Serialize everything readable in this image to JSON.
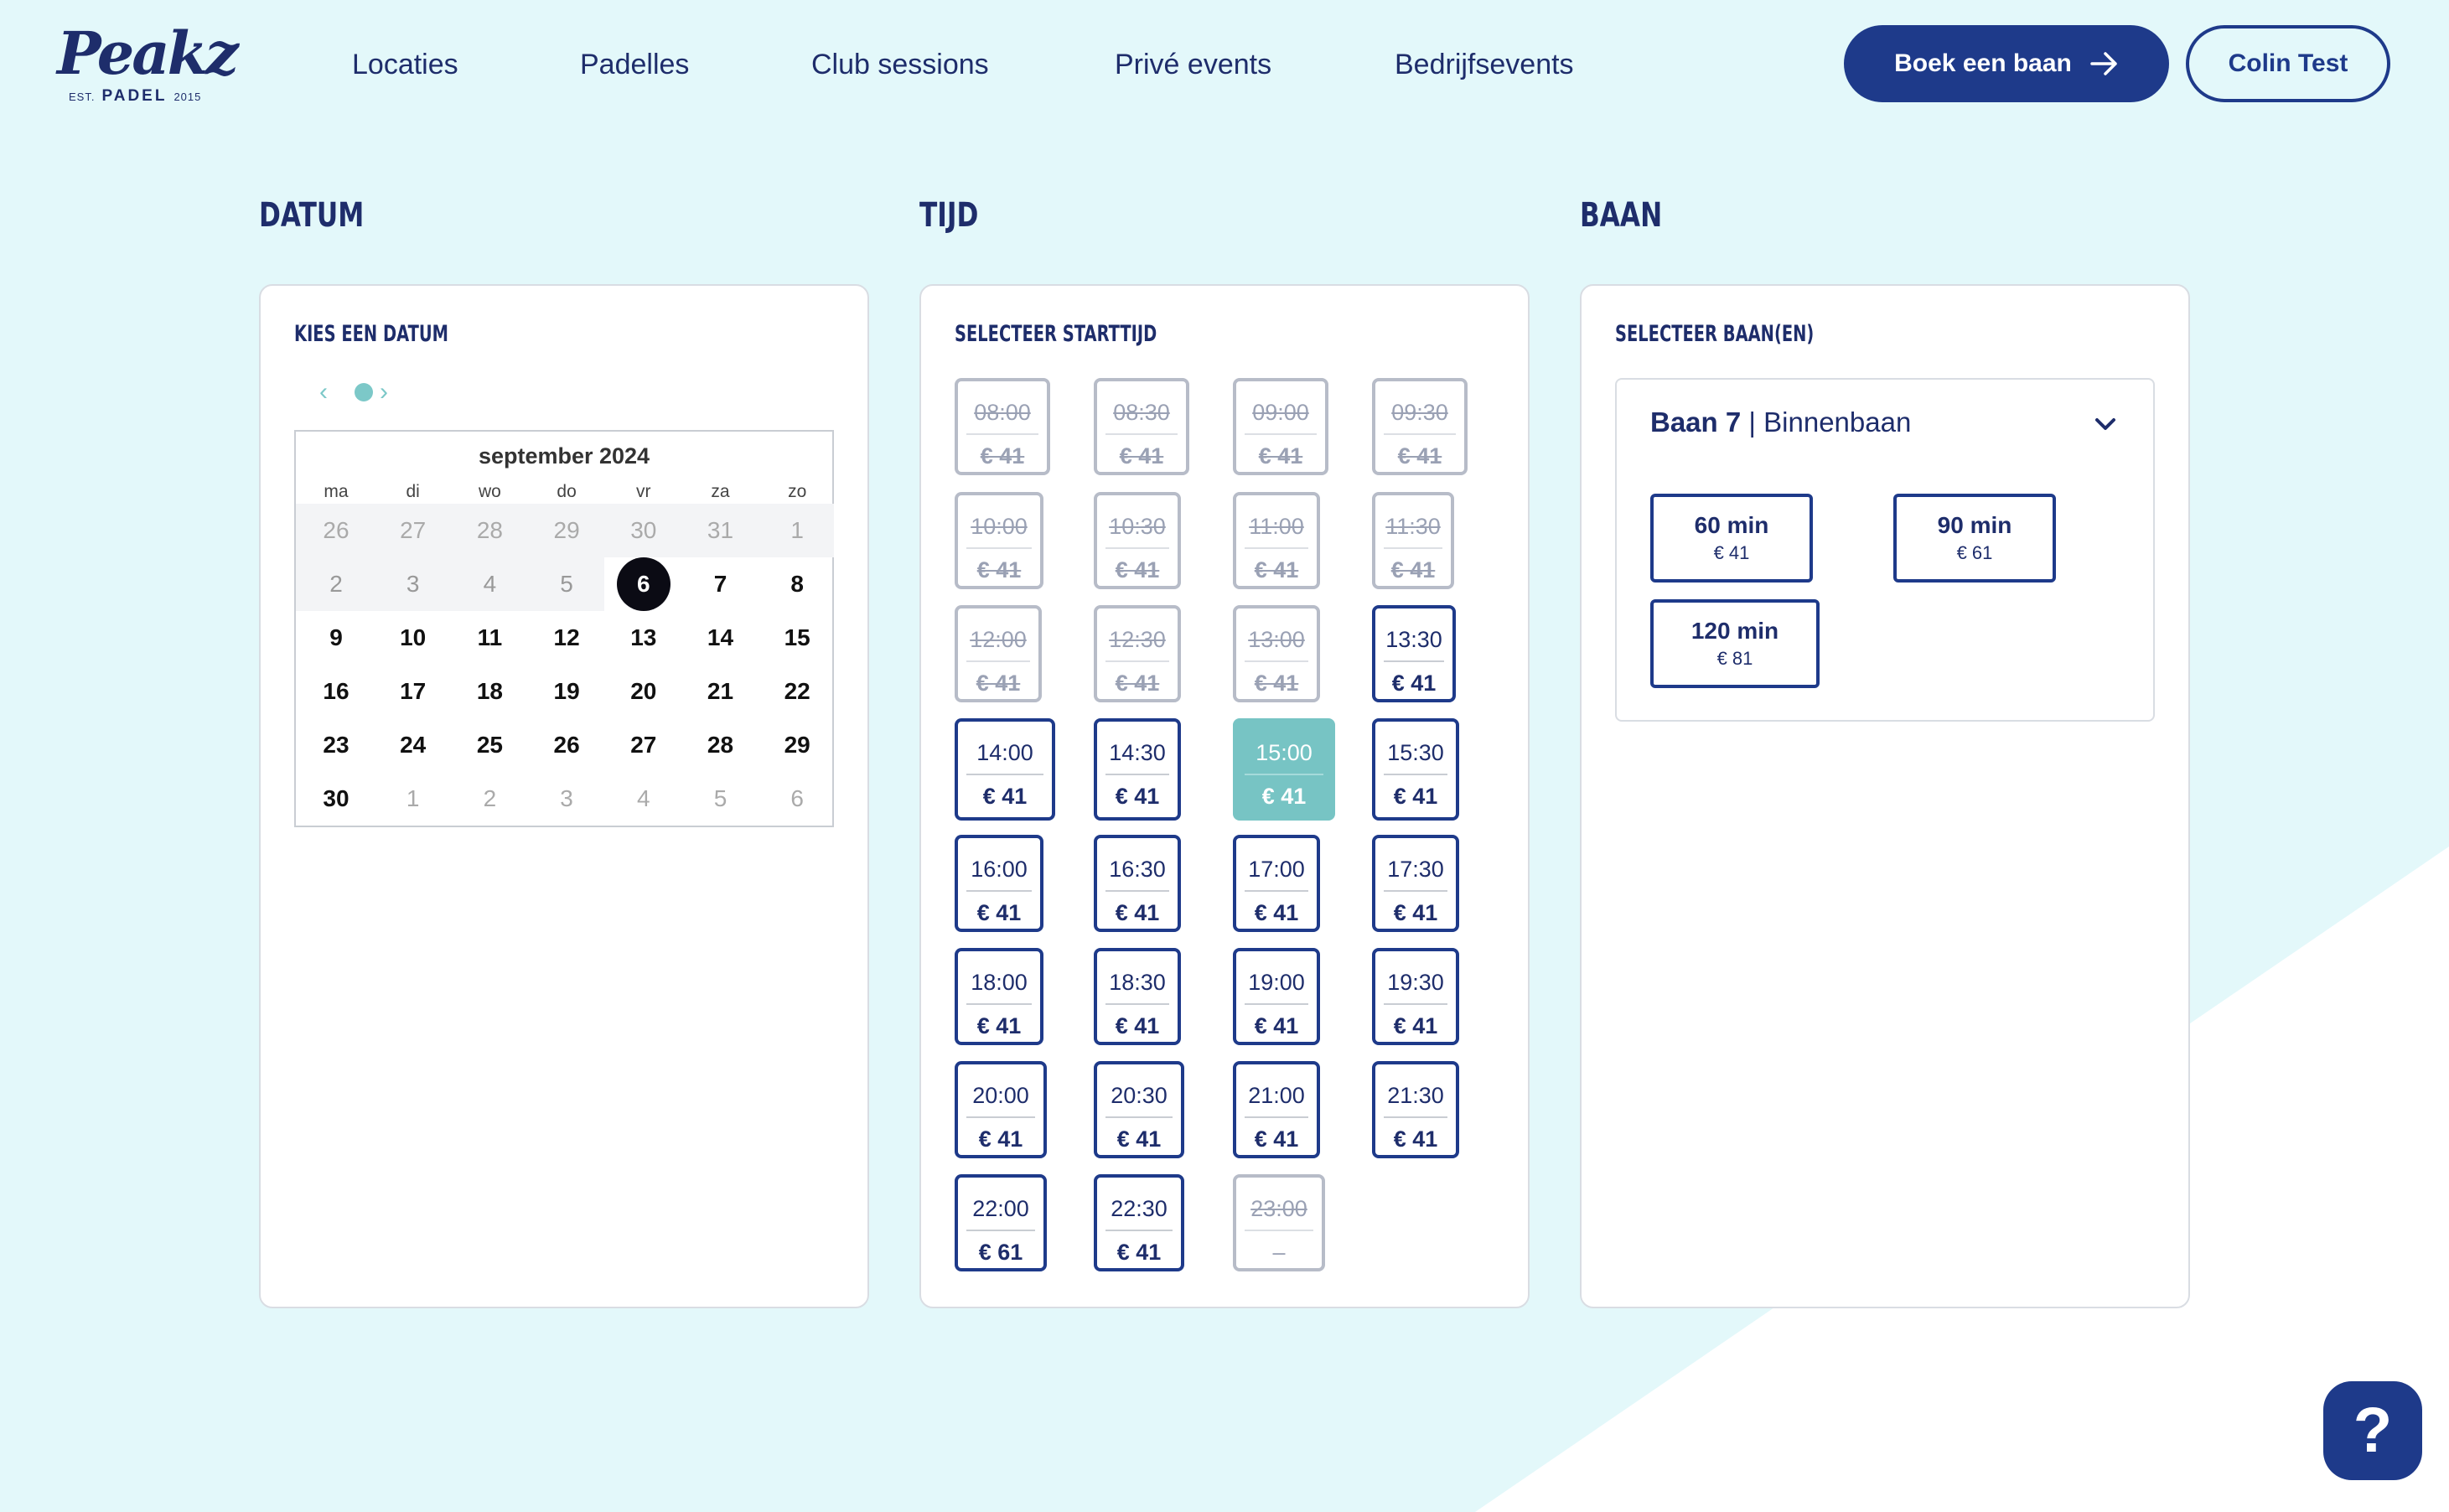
{
  "brand": {
    "script": "Peakz",
    "est": "EST.",
    "name": "PADEL",
    "year": "2015"
  },
  "nav": [
    "Locaties",
    "Padelles",
    "Club sessions",
    "Privé events",
    "Bedrijfsevents"
  ],
  "header": {
    "book_label": "Boek een baan",
    "user_label": "Colin Test"
  },
  "sections": {
    "date": {
      "title": "DATUM",
      "label": "KIES EEN DATUM"
    },
    "time": {
      "title": "TIJD",
      "label": "SELECTEER STARTTIJD"
    },
    "court": {
      "title": "BAAN",
      "label": "SELECTEER BAAN(EN)"
    }
  },
  "calendar": {
    "month": "september 2024",
    "weekdays": [
      "ma",
      "di",
      "wo",
      "do",
      "vr",
      "za",
      "zo"
    ],
    "weeks": [
      [
        "26",
        "27",
        "28",
        "29",
        "30",
        "31",
        "1"
      ],
      [
        "2",
        "3",
        "4",
        "5",
        "6",
        "7",
        "8"
      ],
      [
        "9",
        "10",
        "11",
        "12",
        "13",
        "14",
        "15"
      ],
      [
        "16",
        "17",
        "18",
        "19",
        "20",
        "21",
        "22"
      ],
      [
        "23",
        "24",
        "25",
        "26",
        "27",
        "28",
        "29"
      ],
      [
        "30",
        "1",
        "2",
        "3",
        "4",
        "5",
        "6"
      ]
    ],
    "selected": "6"
  },
  "slots": [
    {
      "time": "08:00",
      "price": "€ 41",
      "state": "unavailable"
    },
    {
      "time": "08:30",
      "price": "€ 41",
      "state": "unavailable"
    },
    {
      "time": "09:00",
      "price": "€ 41",
      "state": "unavailable"
    },
    {
      "time": "09:30",
      "price": "€ 41",
      "state": "unavailable"
    },
    {
      "time": "10:00",
      "price": "€ 41",
      "state": "unavailable"
    },
    {
      "time": "10:30",
      "price": "€ 41",
      "state": "unavailable"
    },
    {
      "time": "11:00",
      "price": "€ 41",
      "state": "unavailable"
    },
    {
      "time": "11:30",
      "price": "€ 41",
      "state": "unavailable"
    },
    {
      "time": "12:00",
      "price": "€ 41",
      "state": "unavailable"
    },
    {
      "time": "12:30",
      "price": "€ 41",
      "state": "unavailable"
    },
    {
      "time": "13:00",
      "price": "€ 41",
      "state": "unavailable"
    },
    {
      "time": "13:30",
      "price": "€ 41",
      "state": "available"
    },
    {
      "time": "14:00",
      "price": "€ 41",
      "state": "available"
    },
    {
      "time": "14:30",
      "price": "€ 41",
      "state": "available"
    },
    {
      "time": "15:00",
      "price": "€ 41",
      "state": "selected"
    },
    {
      "time": "15:30",
      "price": "€ 41",
      "state": "available"
    },
    {
      "time": "16:00",
      "price": "€ 41",
      "state": "available"
    },
    {
      "time": "16:30",
      "price": "€ 41",
      "state": "available"
    },
    {
      "time": "17:00",
      "price": "€ 41",
      "state": "available"
    },
    {
      "time": "17:30",
      "price": "€ 41",
      "state": "available"
    },
    {
      "time": "18:00",
      "price": "€ 41",
      "state": "available"
    },
    {
      "time": "18:30",
      "price": "€ 41",
      "state": "available"
    },
    {
      "time": "19:00",
      "price": "€ 41",
      "state": "available"
    },
    {
      "time": "19:30",
      "price": "€ 41",
      "state": "available"
    },
    {
      "time": "20:00",
      "price": "€ 41",
      "state": "available"
    },
    {
      "time": "20:30",
      "price": "€ 41",
      "state": "available"
    },
    {
      "time": "21:00",
      "price": "€ 41",
      "state": "available"
    },
    {
      "time": "21:30",
      "price": "€ 41",
      "state": "available"
    },
    {
      "time": "22:00",
      "price": "€ 61",
      "state": "available"
    },
    {
      "time": "22:30",
      "price": "€ 41",
      "state": "available"
    },
    {
      "time": "23:00",
      "price": "–",
      "state": "unavailable-noprice"
    }
  ],
  "court": {
    "name": "Baan 7",
    "separator": "|",
    "type": "Binnenbaan",
    "durations": [
      {
        "label": "60 min",
        "price": "€ 41"
      },
      {
        "label": "90 min",
        "price": "€ 61"
      },
      {
        "label": "120 min",
        "price": "€ 81"
      }
    ]
  },
  "help": {
    "label": "?"
  },
  "colors": {
    "background": "#e3f8fa",
    "primary": "#1e3a8a",
    "selected_slot": "#77c4c4"
  },
  "icons": {
    "book_arrow": "arrow-right-icon",
    "court_toggle": "chevron-down-icon",
    "prev": "chevron-left-icon",
    "next": "chevron-right-icon"
  }
}
